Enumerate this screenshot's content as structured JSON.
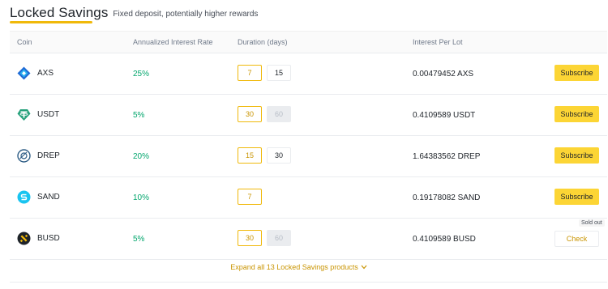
{
  "header": {
    "title": "Locked Savings",
    "subtitle": "Fixed deposit, potentially higher rewards"
  },
  "columns": {
    "coin": "Coin",
    "rate": "Annualized Interest Rate",
    "duration": "Duration (days)",
    "interest": "Interest Per Lot"
  },
  "rows": [
    {
      "coin": "AXS",
      "rate": "25%",
      "durations": [
        {
          "label": "7",
          "state": "selected"
        },
        {
          "label": "15",
          "state": "normal"
        }
      ],
      "interest": "0.00479452 AXS",
      "action": "Subscribe"
    },
    {
      "coin": "USDT",
      "rate": "5%",
      "durations": [
        {
          "label": "30",
          "state": "selected"
        },
        {
          "label": "60",
          "state": "disabled"
        }
      ],
      "interest": "0.4109589 USDT",
      "action": "Subscribe"
    },
    {
      "coin": "DREP",
      "rate": "20%",
      "durations": [
        {
          "label": "15",
          "state": "selected"
        },
        {
          "label": "30",
          "state": "normal"
        }
      ],
      "interest": "1.64383562 DREP",
      "action": "Subscribe"
    },
    {
      "coin": "SAND",
      "rate": "10%",
      "durations": [
        {
          "label": "7",
          "state": "selected"
        }
      ],
      "interest": "0.19178082 SAND",
      "action": "Subscribe"
    },
    {
      "coin": "BUSD",
      "rate": "5%",
      "durations": [
        {
          "label": "30",
          "state": "selected"
        },
        {
          "label": "60",
          "state": "disabled"
        }
      ],
      "interest": "0.4109589 BUSD",
      "action": "Check",
      "badge": "Sold out"
    }
  ],
  "expand_label": "Expand all 13 Locked Savings products",
  "colors": {
    "accent": "#f0b90b",
    "button": "#fcd535",
    "positive": "#03a66d"
  },
  "icons": [
    "axs-coin-icon",
    "usdt-coin-icon",
    "drep-coin-icon",
    "sand-coin-icon",
    "busd-coin-icon",
    "chevron-down-icon"
  ]
}
